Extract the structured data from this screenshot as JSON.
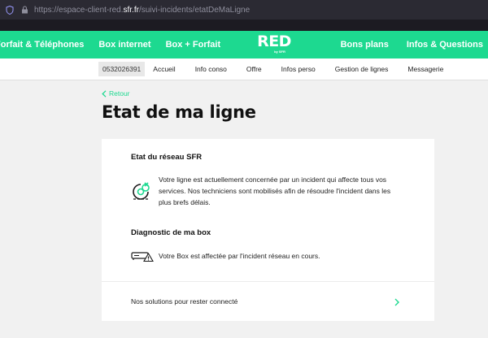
{
  "browser": {
    "url_prefix": "https://espace-client-red.",
    "url_domain": "sfr.fr",
    "url_suffix": "/suivi-incidents/etatDeMaLigne"
  },
  "topnav": {
    "left_items": [
      "Forfait & Téléphones",
      "Box internet",
      "Box + Forfait"
    ],
    "logo_text": "RED",
    "logo_sub": "by SFR",
    "right_items": [
      "Bons plans",
      "Infos & Questions"
    ],
    "accent_color": "#1dd990"
  },
  "subnav": {
    "phone": "0532026391",
    "items": [
      "Accueil",
      "Info conso",
      "Offre",
      "Infos perso",
      "Gestion de lignes",
      "Messagerie"
    ]
  },
  "page": {
    "back_label": "Retour",
    "title": "Etat de ma ligne"
  },
  "card": {
    "network": {
      "title": "Etat du réseau SFR",
      "icon": "network-incident-icon",
      "message": "Votre ligne est actuellement concernée par un incident qui affecte tous vos services. Nos techniciens sont mobilisés afin de résoudre l'incident dans les plus brefs délais."
    },
    "box": {
      "title": "Diagnostic de ma box",
      "icon": "box-warning-icon",
      "message": "Votre Box est affectée par l'incident réseau en cours."
    },
    "solutions_label": "Nos solutions pour rester connecté"
  }
}
